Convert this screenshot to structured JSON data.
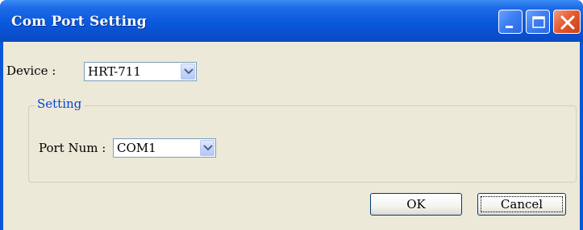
{
  "window": {
    "title": "Com Port Setting",
    "controls": [
      "minimize-icon",
      "maximize-icon",
      "close-icon"
    ]
  },
  "device": {
    "label": "Device :",
    "value": "HRT-711"
  },
  "setting_group": {
    "legend": "Setting",
    "port_label": "Port Num :",
    "port_value": "COM1"
  },
  "buttons": {
    "ok": "OK",
    "cancel": "Cancel"
  },
  "colors": {
    "titlebar": "#0a58dc",
    "client": "#ece9d8",
    "group_legend": "#0046d5",
    "close_button": "#e3582e"
  }
}
